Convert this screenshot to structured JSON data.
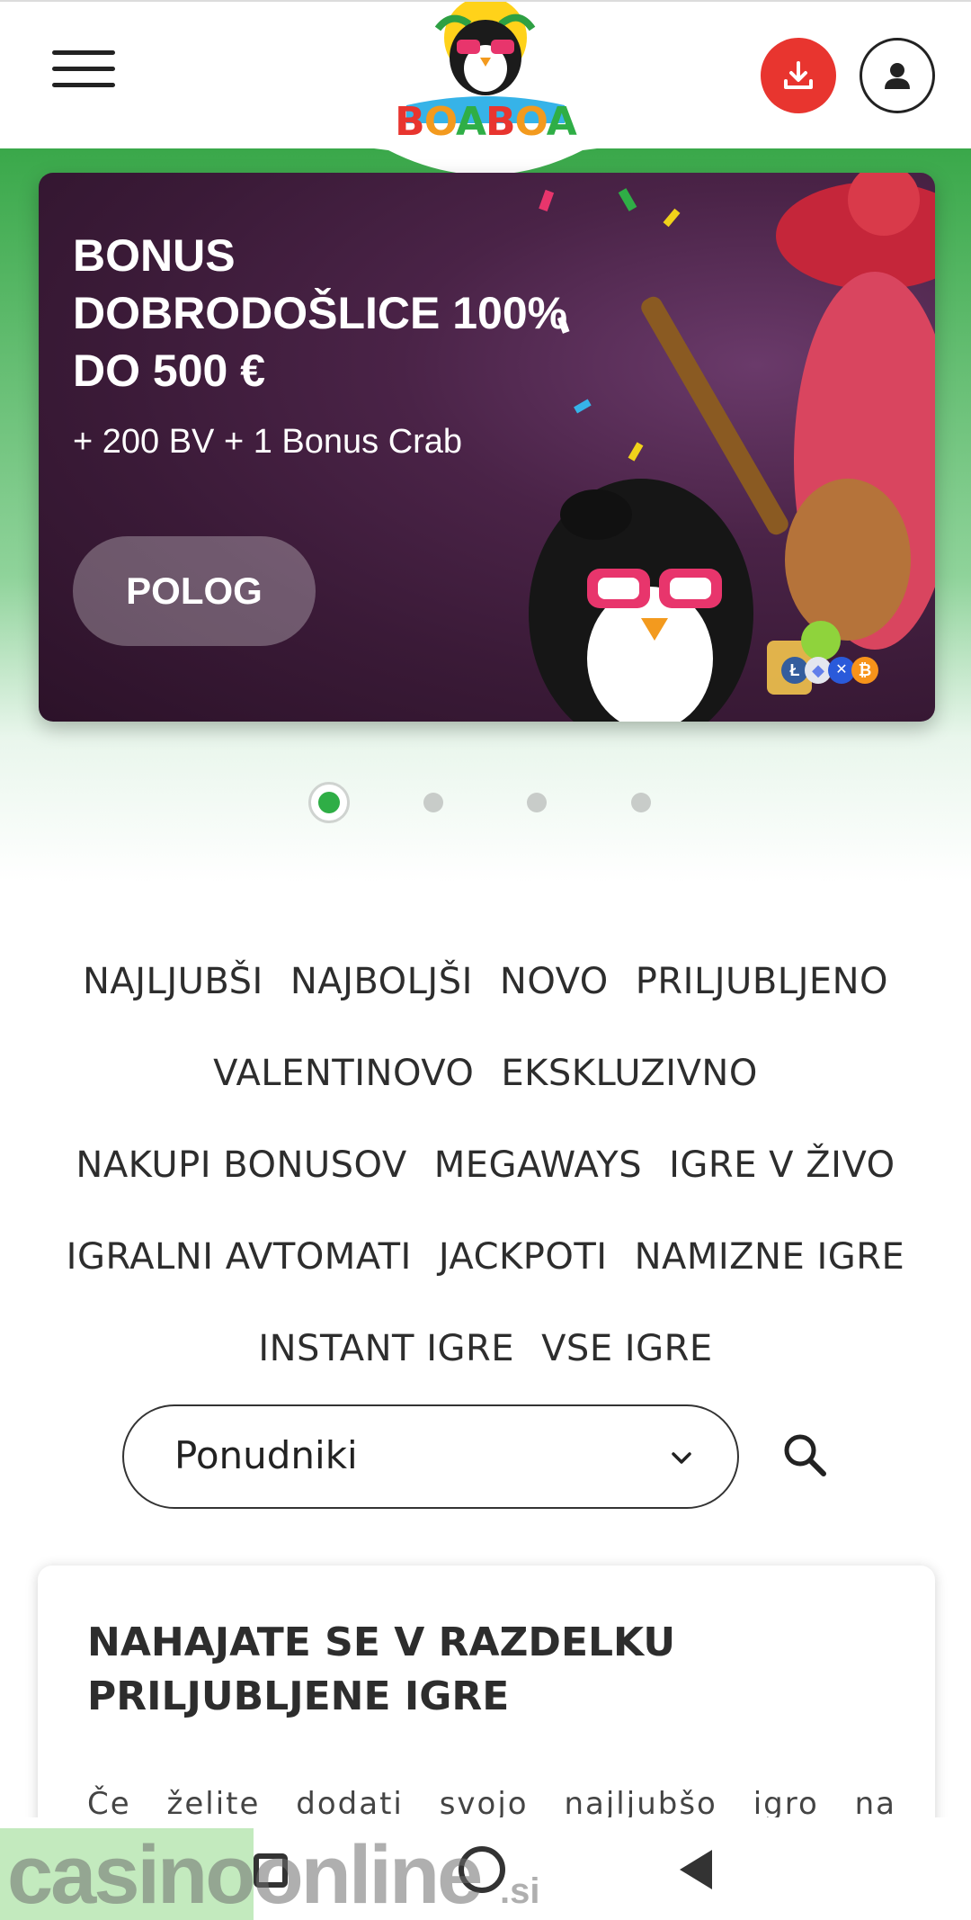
{
  "header": {
    "logo_text": "BOABOA",
    "menu_icon": "hamburger-menu-icon",
    "download_icon": "download-icon",
    "account_icon": "user-icon",
    "colors": {
      "download_bg": "#e8352f",
      "brand_green": "#3aa84a"
    }
  },
  "banner": {
    "title_line1": "BONUS",
    "title_line2": "DOBRODOŠLICE 100%",
    "title_line3": "DO 500 €",
    "subtitle": "+ 200 BV + 1 Bonus Crab",
    "cta_label": "POLOG",
    "crypto_icons": [
      "litecoin-icon",
      "ethereum-icon",
      "ripple-icon",
      "bitcoin-icon"
    ]
  },
  "carousel": {
    "slide_count": 4,
    "active_index": 0
  },
  "categories": {
    "rows": [
      [
        "NAJLJUBŠI",
        "NAJBOLJŠI",
        "NOVO",
        "PRILJUBLJENO"
      ],
      [
        "VALENTINOVO",
        "EKSKLUZIVNO"
      ],
      [
        "NAKUPI BONUSOV",
        "MEGAWAYS",
        "IGRE V ŽIVO"
      ],
      [
        "IGRALNI AVTOMATI",
        "JACKPOTI",
        "NAMIZNE IGRE"
      ],
      [
        "INSTANT IGRE",
        "VSE IGRE"
      ]
    ]
  },
  "filters": {
    "provider_label": "Ponudniki",
    "search_icon": "search-icon"
  },
  "info_card": {
    "title_line1": "NAHAJATE SE V RAZDELKU",
    "title_line2": "PRILJUBLJENE IGRE",
    "text": "Če želite dodati svojo najljubšo igro na seznam,"
  },
  "watermark": {
    "main": "casinoonline",
    "suffix": ".si"
  }
}
